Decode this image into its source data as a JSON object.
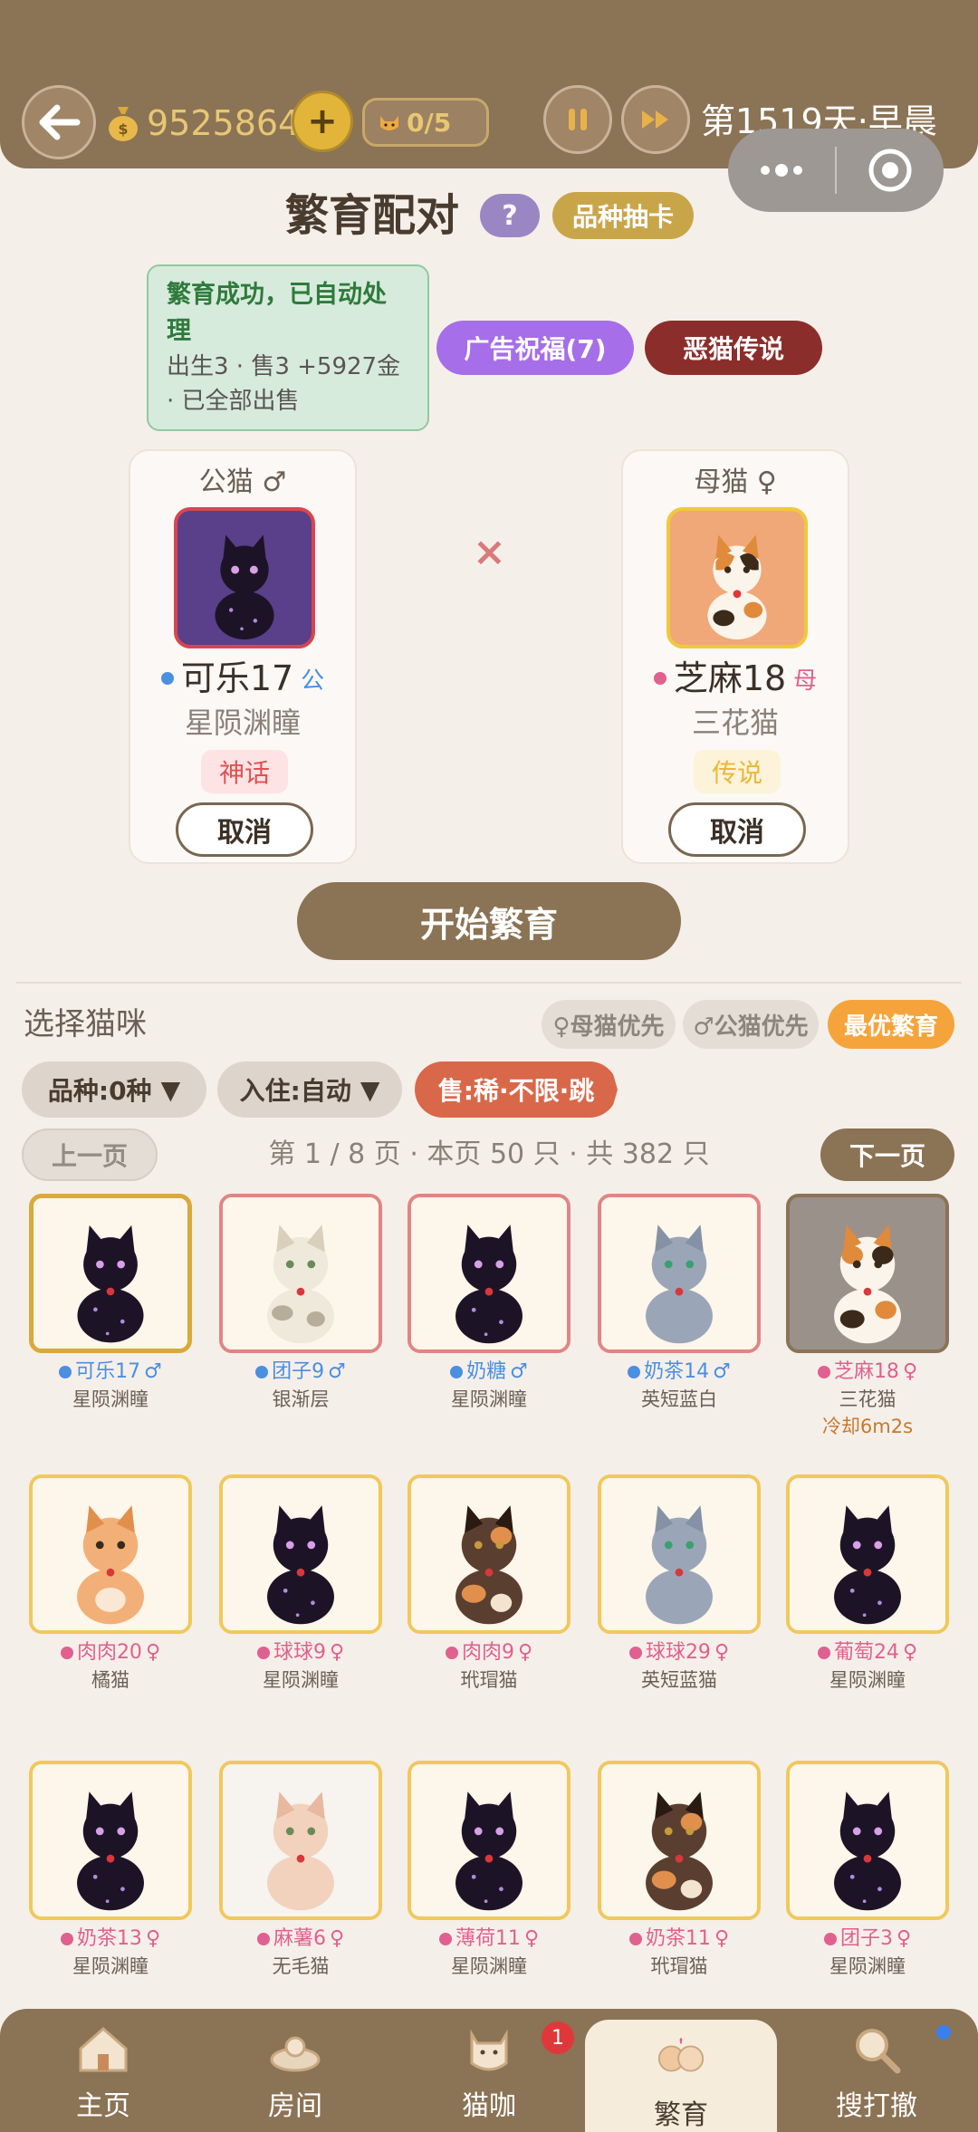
{
  "header": {
    "coins": "9525864",
    "cat_count": "0/5",
    "day": "第1519天·早晨"
  },
  "title": "繁育配对",
  "help_label": "?",
  "draw_label": "品种抽卡",
  "notice": {
    "title": "繁育成功，已自动处理",
    "detail": "出生3 · 售3 +5927金 · 已全部出售"
  },
  "ad_label": "广告祝福(7)",
  "legend_label": "恶猫传说",
  "male": {
    "role": "公猫 ♂",
    "name": "可乐17",
    "sex_tag": "公",
    "breed": "星陨渊瞳",
    "rarity": "神话",
    "cancel": "取消"
  },
  "female": {
    "role": "母猫 ♀",
    "name": "芝麻18",
    "sex_tag": "母",
    "breed": "三花猫",
    "rarity": "传说",
    "cancel": "取消"
  },
  "cross": "×",
  "start_label": "开始繁育",
  "select_title": "选择猫咪",
  "sort": {
    "female_first": "♀母猫优先",
    "male_first": "♂公猫优先",
    "best": "最优繁育"
  },
  "filters": {
    "breed": "品种:0种",
    "stay": "入住:自动",
    "sell": "售:稀·不限·跳"
  },
  "pager": {
    "prev": "上一页",
    "info": "第 1 / 8 页 · 本页 50 只 · 共 382 只",
    "next": "下一页"
  },
  "colors": {
    "male_dot": "#4a8fe0",
    "female_dot": "#e0608f",
    "header_bg": "#8b7355"
  },
  "cats": [
    {
      "name": "可乐17",
      "sex": "♂",
      "breed": "星陨渊瞳",
      "kind": "black",
      "gender": "m",
      "frame": "gold"
    },
    {
      "name": "团子9",
      "sex": "♂",
      "breed": "银渐层",
      "kind": "silver",
      "gender": "m",
      "frame": "red"
    },
    {
      "name": "奶糖",
      "sex": "♂",
      "breed": "星陨渊瞳",
      "kind": "black",
      "gender": "m",
      "frame": "red"
    },
    {
      "name": "奶茶14",
      "sex": "♂",
      "breed": "英短蓝白",
      "kind": "blue",
      "gender": "m",
      "frame": "red"
    },
    {
      "name": "芝麻18",
      "sex": "♀",
      "breed": "三花猫",
      "kind": "calico",
      "gender": "f",
      "frame": "dark",
      "cool": "冷却6m2s"
    },
    {
      "name": "肉肉20",
      "sex": "♀",
      "breed": "橘猫",
      "kind": "orange",
      "gender": "f",
      "frame": "yellow"
    },
    {
      "name": "球球9",
      "sex": "♀",
      "breed": "星陨渊瞳",
      "kind": "black",
      "gender": "f",
      "frame": "yellow"
    },
    {
      "name": "肉肉9",
      "sex": "♀",
      "breed": "玳瑁猫",
      "kind": "tortie",
      "gender": "f",
      "frame": "yellow"
    },
    {
      "name": "球球29",
      "sex": "♀",
      "breed": "英短蓝猫",
      "kind": "blue",
      "gender": "f",
      "frame": "yellow"
    },
    {
      "name": "葡萄24",
      "sex": "♀",
      "breed": "星陨渊瞳",
      "kind": "black",
      "gender": "f",
      "frame": "yellow"
    },
    {
      "name": "奶茶13",
      "sex": "♀",
      "breed": "星陨渊瞳",
      "kind": "black",
      "gender": "f",
      "frame": "yellow"
    },
    {
      "name": "麻薯6",
      "sex": "♀",
      "breed": "无毛猫",
      "kind": "sphynx",
      "gender": "f",
      "frame": "yellow"
    },
    {
      "name": "薄荷11",
      "sex": "♀",
      "breed": "星陨渊瞳",
      "kind": "black",
      "gender": "f",
      "frame": "yellow"
    },
    {
      "name": "奶茶11",
      "sex": "♀",
      "breed": "玳瑁猫",
      "kind": "tortie",
      "gender": "f",
      "frame": "yellow"
    },
    {
      "name": "团子3",
      "sex": "♀",
      "breed": "星陨渊瞳",
      "kind": "black",
      "gender": "f",
      "frame": "yellow"
    }
  ],
  "nav": {
    "home": "主页",
    "room": "房间",
    "cafe": "猫咖",
    "breed": "繁育",
    "search": "搜打撤",
    "badge": "1"
  }
}
